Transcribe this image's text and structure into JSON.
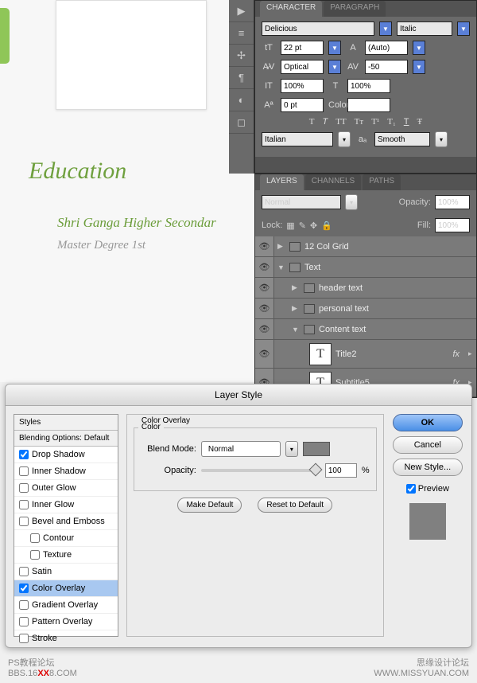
{
  "canvas": {
    "title": "Education",
    "subtitle": "Shri Ganga Higher Secondar",
    "degree": "Master Degree 1st"
  },
  "character": {
    "tab1": "CHARACTER",
    "tab2": "PARAGRAPH",
    "font": "Delicious",
    "style": "Italic",
    "size": "22 pt",
    "leading": "(Auto)",
    "kerning": "Optical",
    "tracking": "-50",
    "vscale": "100%",
    "hscale": "100%",
    "baseline": "0 pt",
    "colorlbl": "Color:",
    "lang": "Italian",
    "aa": "Smooth"
  },
  "layers": {
    "tab1": "LAYERS",
    "tab2": "CHANNELS",
    "tab3": "PATHS",
    "blend": "Normal",
    "opacitylbl": "Opacity:",
    "opacity": "100%",
    "locklbl": "Lock:",
    "filllbl": "Fill:",
    "fill": "100%",
    "items": [
      "12 Col Grid",
      "Text",
      "header text",
      "personal text",
      "Content text",
      "Title2",
      "Subtitle5"
    ],
    "fx": "fx"
  },
  "ls": {
    "title": "Layer Style",
    "left_hd1": "Styles",
    "left_hd2": "Blending Options: Default",
    "items": [
      "Drop Shadow",
      "Inner Shadow",
      "Outer Glow",
      "Inner Glow",
      "Bevel and Emboss",
      "Contour",
      "Texture",
      "Satin",
      "Color Overlay",
      "Gradient Overlay",
      "Pattern Overlay",
      "Stroke"
    ],
    "section": "Color Overlay",
    "sub": "Color",
    "blendlbl": "Blend Mode:",
    "blendval": "Normal",
    "oplbl": "Opacity:",
    "opval": "100",
    "pct": "%",
    "makedef": "Make Default",
    "resetdef": "Reset to Default",
    "ok": "OK",
    "cancel": "Cancel",
    "newstyle": "New Style...",
    "preview": "Preview"
  },
  "wm": {
    "left1": "PS教程论坛",
    "left2": "BBS.16",
    "left3": "XX",
    "left4": "8.COM",
    "right1": "思缘设计论坛",
    "right2": "WWW.MISSYUAN.COM"
  }
}
